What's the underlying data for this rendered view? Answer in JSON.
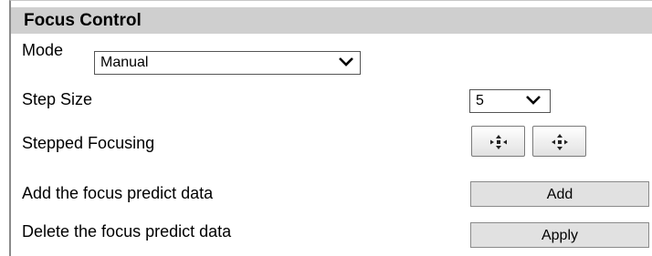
{
  "panel": {
    "title": "Focus Control"
  },
  "mode": {
    "label": "Mode",
    "value": "Manual"
  },
  "step_size": {
    "label": "Step Size",
    "value": "5"
  },
  "stepped_focusing": {
    "label": "Stepped Focusing",
    "near_icon": "focus-near-icon",
    "far_icon": "focus-far-icon"
  },
  "add_predict": {
    "label": "Add the focus predict data",
    "button": "Add"
  },
  "delete_predict": {
    "label": "Delete the focus predict data",
    "button": "Apply"
  }
}
